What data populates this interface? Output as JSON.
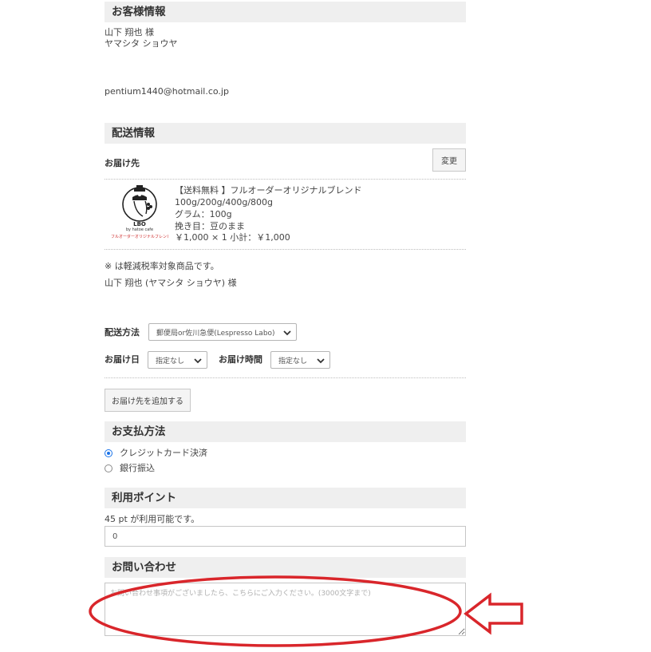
{
  "customer": {
    "heading": "お客様情報",
    "name": "山下 翔也 様",
    "kana": "ヤマシタ ショウヤ",
    "email": "pentium1440@hotmail.co.jp"
  },
  "shipping": {
    "heading": "配送情報",
    "destination_label": "お届け先",
    "change_button": "変更",
    "product": {
      "thumb_title": "LBO",
      "thumb_subtitle": "by hatoe cafe",
      "thumb_caption": "フルオーダーオリジナルブレンド",
      "name": "【送料無料 】フルオーダーオリジナルブレンド",
      "variants": "100g/200g/400g/800g",
      "gram": "グラム：100g",
      "grind": "挽き目：豆のまま",
      "price": "￥1,000 × 1  小計：￥1,000"
    },
    "tax_note": "※ は軽減税率対象商品です。",
    "recipient": "山下 翔也 (ヤマシタ ショウヤ) 様",
    "method_label": "配送方法",
    "method_value": "郵便局or佐川急便(Lespresso Labo)",
    "date_label": "お届け日",
    "date_value": "指定なし",
    "time_label": "お届け時間",
    "time_value": "指定なし",
    "add_destination_button": "お届け先を追加する"
  },
  "payment": {
    "heading": "お支払方法",
    "options": [
      {
        "label": "クレジットカード決済",
        "selected": true
      },
      {
        "label": "銀行振込",
        "selected": false
      }
    ]
  },
  "points": {
    "heading": "利用ポイント",
    "available": "45 pt が利用可能です。",
    "value": "0"
  },
  "inquiry": {
    "heading": "お問い合わせ",
    "placeholder": "お問い合わせ事項がございましたら、こちらにご入力ください。(3000文字まで)"
  },
  "annotation": {
    "color": "#d9262b"
  }
}
